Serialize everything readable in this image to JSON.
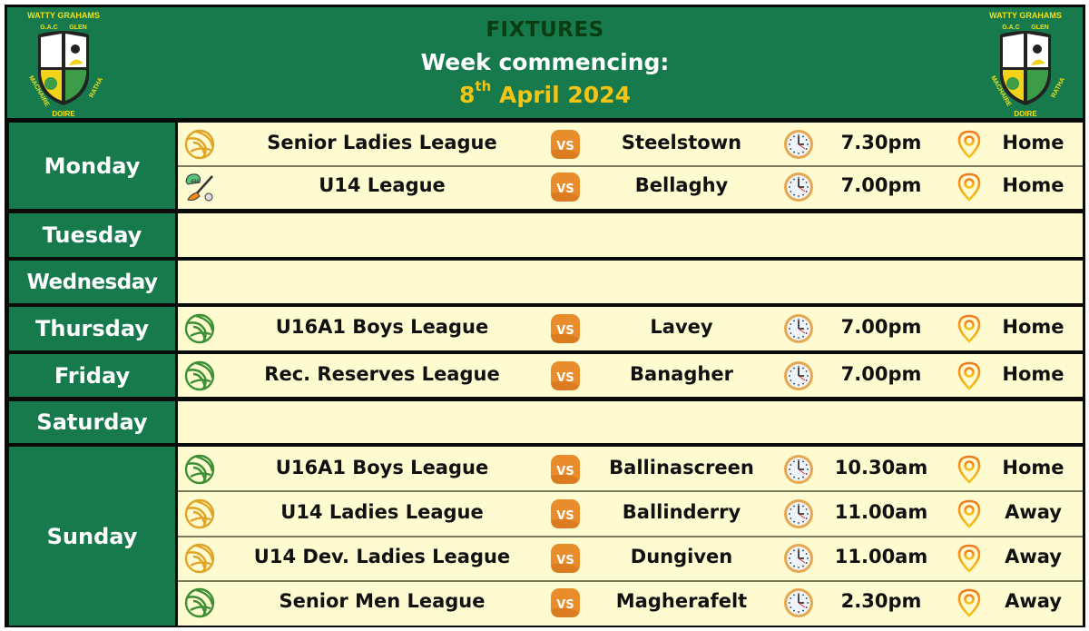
{
  "header": {
    "title": "FIXTURES",
    "subtitle": "Week commencing:",
    "date_day": "8",
    "date_suffix": "th",
    "date_rest": " April 2024",
    "crest": {
      "top_text": "WATTY GRAHAMS",
      "left_small": "G.A.C",
      "right_small": "GLEN",
      "left_side": "MACHAIRE",
      "right_side": "RATHA",
      "bottom_text": "DOIRE"
    }
  },
  "colors": {
    "header_green": "#167a4c",
    "title_dark_green": "#0b3d12",
    "date_yellow": "#f3c414",
    "cell_cream": "#fffbd0",
    "vs_orange": "#e98d2c",
    "ladies_ball": "#e0a526",
    "men_ball": "#3d8f35"
  },
  "vs_label": "VS",
  "days": [
    {
      "name": "Monday",
      "fixtures": [
        {
          "icon": "ladies-football-icon",
          "competition": "Senior Ladies League",
          "opponent": "Steelstown",
          "time": "7.30pm",
          "venue": "Home"
        },
        {
          "icon": "hurling-icon",
          "competition": "U14 League",
          "opponent": "Bellaghy",
          "time": "7.00pm",
          "venue": "Home"
        }
      ]
    },
    {
      "name": "Tuesday",
      "fixtures": []
    },
    {
      "name": "Wednesday",
      "fixtures": []
    },
    {
      "name": "Thursday",
      "fixtures": [
        {
          "icon": "football-icon",
          "competition": "U16A1 Boys League",
          "opponent": "Lavey",
          "time": "7.00pm",
          "venue": "Home"
        }
      ]
    },
    {
      "name": "Friday",
      "fixtures": [
        {
          "icon": "football-icon",
          "competition": "Rec. Reserves League",
          "opponent": "Banagher",
          "time": "7.00pm",
          "venue": "Home"
        }
      ]
    },
    {
      "name": "Saturday",
      "fixtures": []
    },
    {
      "name": "Sunday",
      "fixtures": [
        {
          "icon": "football-icon",
          "competition": "U16A1 Boys League",
          "opponent": "Ballinascreen",
          "time": "10.30am",
          "venue": "Home"
        },
        {
          "icon": "ladies-football-icon",
          "competition": "U14 Ladies League",
          "opponent": "Ballinderry",
          "time": "11.00am",
          "venue": "Away"
        },
        {
          "icon": "ladies-football-icon",
          "competition": "U14 Dev. Ladies League",
          "opponent": "Dungiven",
          "time": "11.00am",
          "venue": "Away"
        },
        {
          "icon": "football-icon",
          "competition": "Senior Men League",
          "opponent": "Magherafelt",
          "time": "2.30pm",
          "venue": "Away"
        }
      ]
    }
  ]
}
